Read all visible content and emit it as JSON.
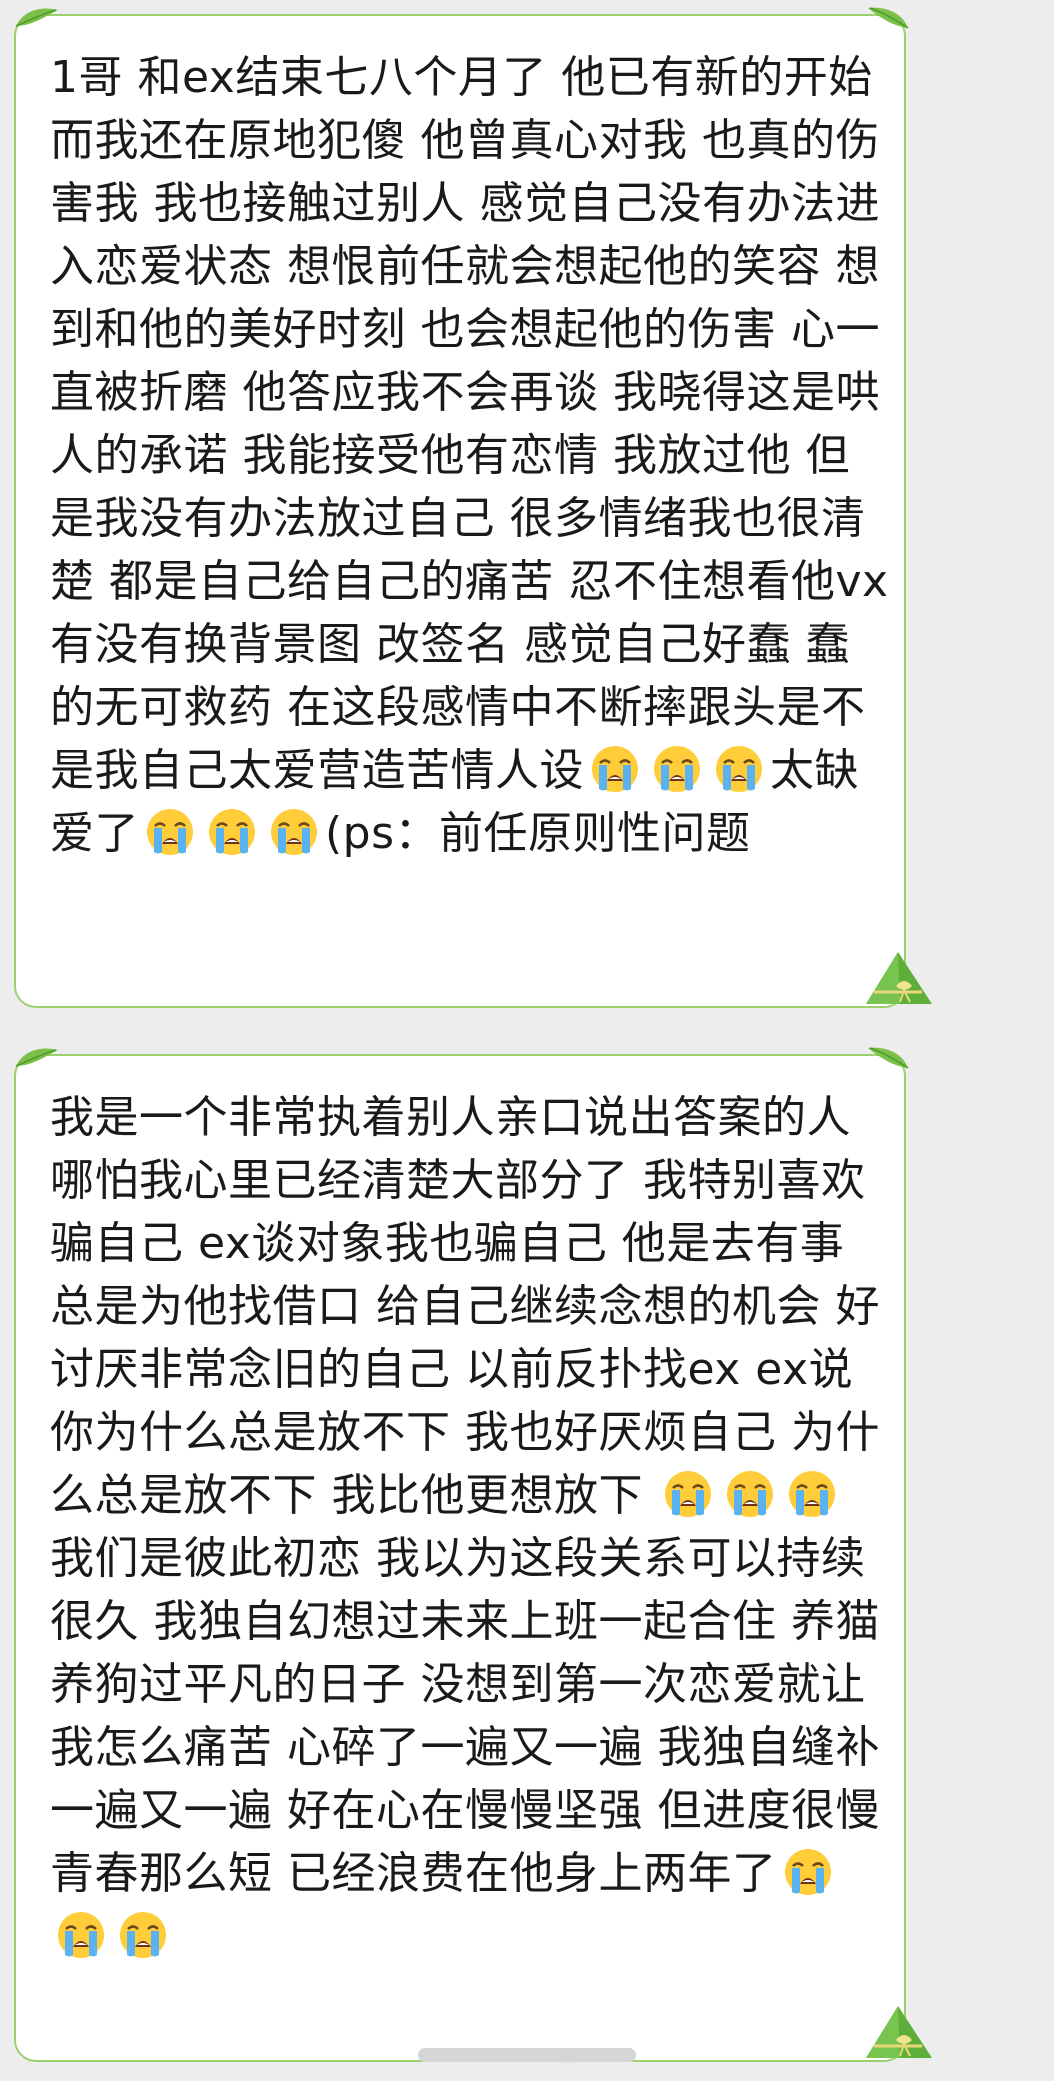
{
  "messages": [
    {
      "id": "message-1",
      "segments": [
        {
          "type": "text",
          "value": "1哥 和ex结束七八个月了 他已有新的开始 而我还在原地犯傻 他曾真心对我 也真的伤害我 我也接触过别人 感觉自己没有办法进入恋爱状态 想恨前任就会想起他的笑容 想到和他的美好时刻 也会想起他的伤害 心一直被折磨 他答应我不会再谈 我晓得这是哄人的承诺 我能接受他有恋情 我放过他 但是我没有办法放过自己 很多情绪我也很清楚 都是自己给自己的痛苦 忍不住想看他vx 有没有换背景图 改签名 感觉自己好蠢 蠢的无可救药 在这段感情中不断摔跟头是不是我自己太爱营造苦情人设"
        },
        {
          "type": "emoji",
          "icon": "loudly-crying-face-icon"
        },
        {
          "type": "emoji",
          "icon": "loudly-crying-face-icon"
        },
        {
          "type": "emoji",
          "icon": "loudly-crying-face-icon"
        },
        {
          "type": "text",
          "value": "太缺爱了"
        },
        {
          "type": "emoji",
          "icon": "loudly-crying-face-icon"
        },
        {
          "type": "emoji",
          "icon": "loudly-crying-face-icon"
        },
        {
          "type": "emoji",
          "icon": "loudly-crying-face-icon"
        },
        {
          "type": "text",
          "value": "(ps：前任原则性问题"
        }
      ]
    },
    {
      "id": "message-2",
      "segments": [
        {
          "type": "text",
          "value": "我是一个非常执着别人亲口说出答案的人 哪怕我心里已经清楚大部分了 我特别喜欢骗自己 ex谈对象我也骗自己 他是去有事 总是为他找借口 给自己继续念想的机会 好讨厌非常念旧的自己 以前反扑找ex ex说你为什么总是放不下 我也好厌烦自己 为什么总是放不下 我比他更想放下 "
        },
        {
          "type": "emoji",
          "icon": "loudly-crying-face-icon"
        },
        {
          "type": "emoji",
          "icon": "loudly-crying-face-icon"
        },
        {
          "type": "emoji",
          "icon": "loudly-crying-face-icon"
        },
        {
          "type": "text",
          "value": " 我们是彼此初恋 我以为这段关系可以持续很久 我独自幻想过未来上班一起合住 养猫养狗过平凡的日子 没想到第一次恋爱就让我怎么痛苦 心碎了一遍又一遍 我独自缝补一遍又一遍 好在心在慢慢坚强 但进度很慢 青春那么短 已经浪费在他身上两年了"
        },
        {
          "type": "emoji",
          "icon": "loudly-crying-face-icon"
        },
        {
          "type": "emoji",
          "icon": "loudly-crying-face-icon"
        },
        {
          "type": "emoji",
          "icon": "loudly-crying-face-icon"
        }
      ]
    }
  ],
  "colors": {
    "background": "#ededed",
    "bubble_fill": "#ffffff",
    "bubble_border": "#9dcf6e",
    "text": "#1a1a1a"
  }
}
